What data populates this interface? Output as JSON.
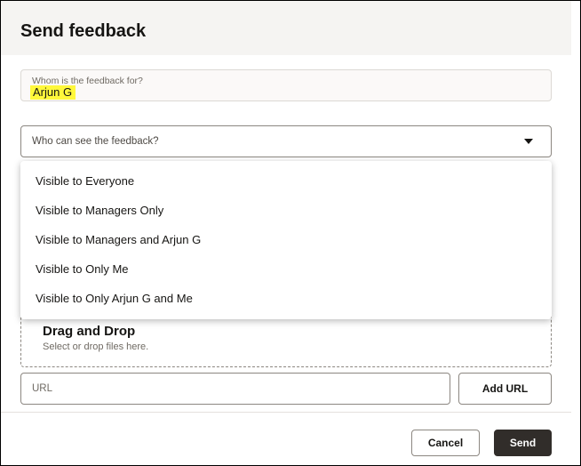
{
  "dialog": {
    "title": "Send feedback"
  },
  "recipient": {
    "label": "Whom is the feedback for?",
    "value": "Arjun G",
    "highlight_color": "#fff83b"
  },
  "visibility": {
    "placeholder": "Who can see the feedback?",
    "options": [
      "Visible to Everyone",
      "Visible to Managers Only",
      "Visible to Managers and Arjun G",
      "Visible to Only Me",
      "Visible to Only Arjun G and Me"
    ]
  },
  "attachments": {
    "title": "Drag and Drop",
    "subtitle": "Select or drop files here.",
    "url_placeholder": "URL",
    "add_url_label": "Add URL"
  },
  "footer": {
    "cancel_label": "Cancel",
    "send_label": "Send"
  },
  "colors": {
    "primary_button": "#312d2a",
    "header_bg": "#f5f4f2"
  }
}
